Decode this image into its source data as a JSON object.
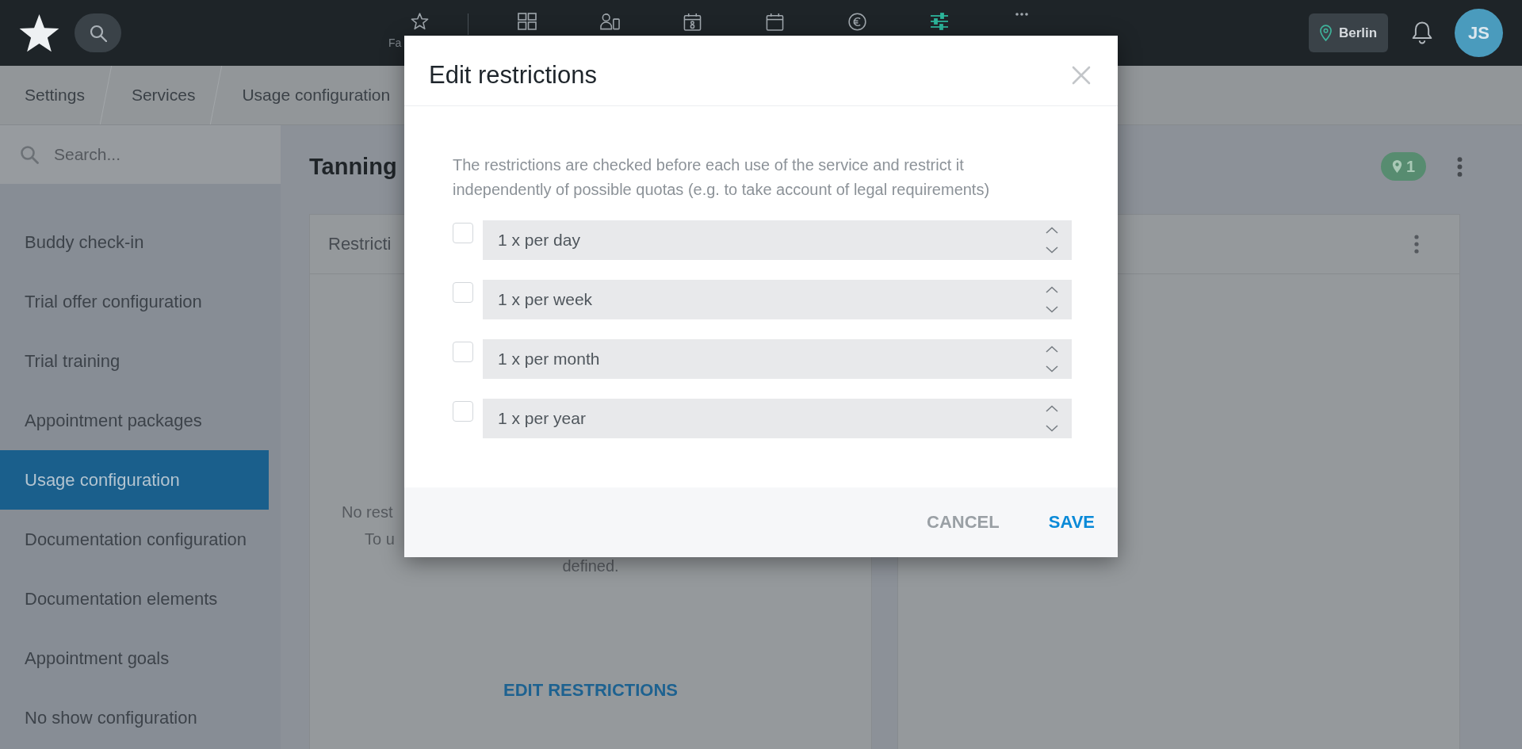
{
  "header": {
    "nav": [
      {
        "label": "Fa",
        "selected": false
      },
      {
        "selected": false
      },
      {
        "selected": false
      },
      {
        "selected": false
      },
      {
        "selected": false
      },
      {
        "selected": false
      },
      {
        "selected": true
      },
      {
        "selected": false
      }
    ],
    "location": "Berlin",
    "avatar": "JS"
  },
  "breadcrumbs": [
    "Settings",
    "Services",
    "Usage configuration"
  ],
  "sidebar": {
    "search_placeholder": "Search...",
    "items": [
      {
        "label": "Buddy check-in",
        "selected": false
      },
      {
        "label": "Trial offer configuration",
        "selected": false
      },
      {
        "label": "Trial training",
        "selected": false
      },
      {
        "label": "Appointment packages",
        "selected": false
      },
      {
        "label": "Usage configuration",
        "selected": true
      },
      {
        "label": "Documentation configuration",
        "selected": false
      },
      {
        "label": "Documentation elements",
        "selected": false
      },
      {
        "label": "Appointment goals",
        "selected": false
      },
      {
        "label": "No show configuration",
        "selected": false
      }
    ]
  },
  "page": {
    "title": "Tanning",
    "badge": "1",
    "restrictions_card": {
      "title": "Restricti",
      "empty_text": [
        "No rest",
        "To u",
        "defined."
      ],
      "action": "EDIT RESTRICTIONS"
    }
  },
  "modal": {
    "title": "Edit restrictions",
    "description": "The restrictions are checked before each use of the service and restrict it independently of possible quotas (e.g. to take account of legal requirements)",
    "restrictions": [
      {
        "checked": false,
        "value": "1 x per day"
      },
      {
        "checked": false,
        "value": "1 x per week"
      },
      {
        "checked": false,
        "value": "1 x per month"
      },
      {
        "checked": false,
        "value": "1 x per year"
      }
    ],
    "buttons": [
      {
        "label": "CANCEL",
        "kind": "secondary"
      },
      {
        "label": "SAVE",
        "kind": "primary"
      }
    ]
  }
}
